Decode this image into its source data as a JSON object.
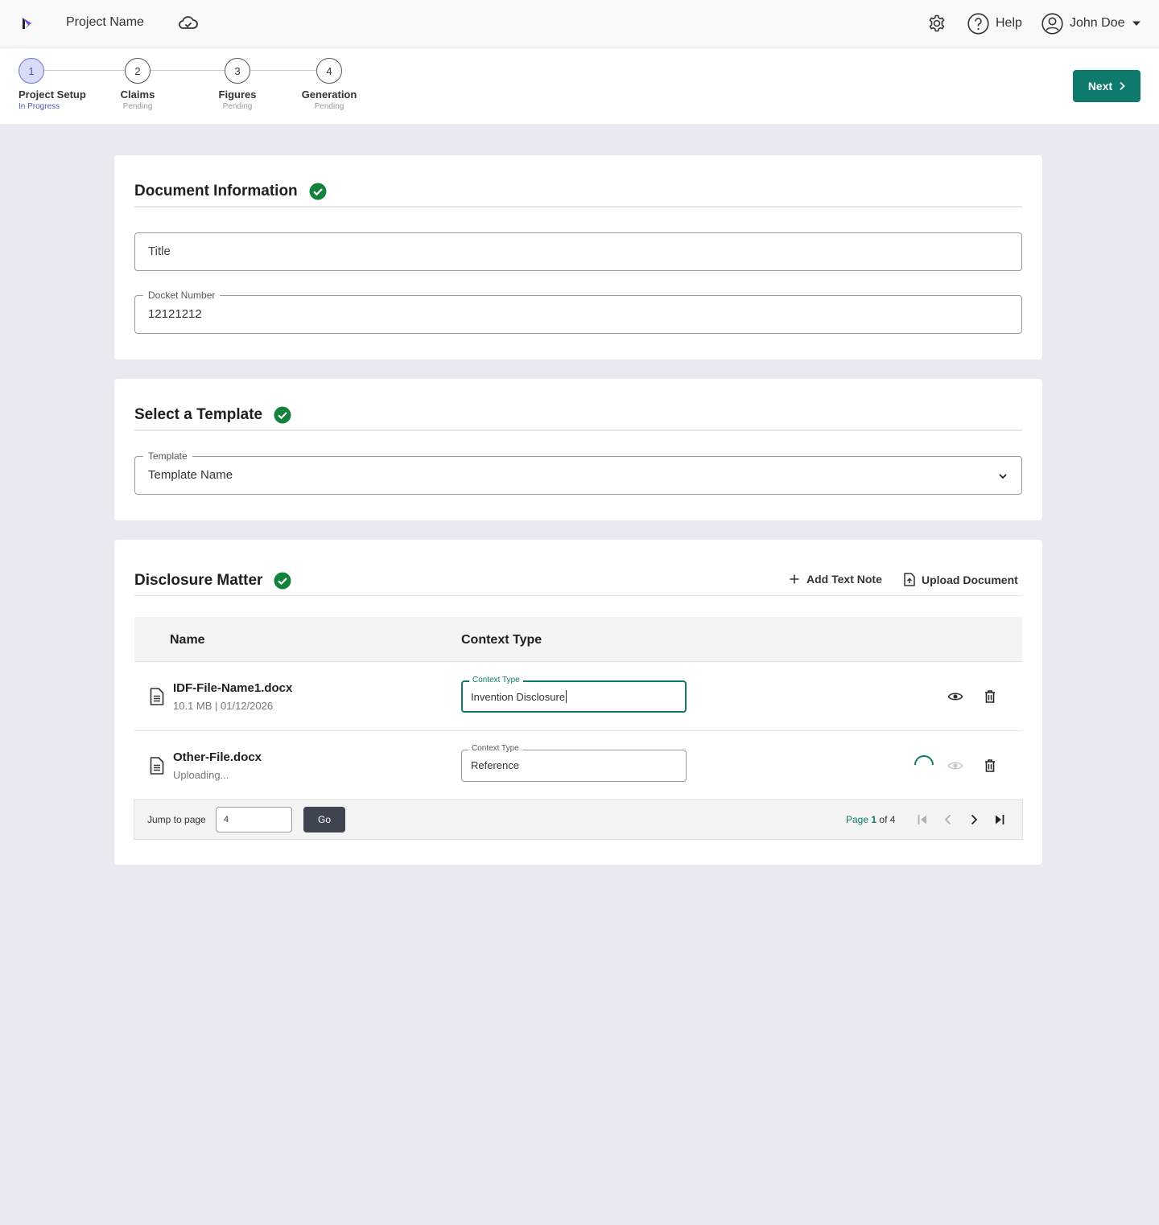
{
  "header": {
    "project_name": "Project Name",
    "help_label": "Help",
    "user_name": "John Doe",
    "icons": [
      "app-logo",
      "cloud-sync-icon",
      "gear-icon",
      "help-icon",
      "user-icon",
      "caret-down-icon"
    ]
  },
  "stepper": {
    "steps": [
      {
        "number": "1",
        "label": "Project Setup",
        "status": "In Progress"
      },
      {
        "number": "2",
        "label": "Claims",
        "status": "Pending"
      },
      {
        "number": "3",
        "label": "Figures",
        "status": "Pending"
      },
      {
        "number": "4",
        "label": "Generation",
        "status": "Pending"
      }
    ],
    "next_label": "Next"
  },
  "document_info": {
    "title": "Document Information",
    "title_field_placeholder": "Title",
    "docket_label": "Docket Number",
    "docket_value": "12121212"
  },
  "template": {
    "title": "Select a Template",
    "field_label": "Template",
    "selected": "Template Name"
  },
  "disclosure": {
    "title": "Disclosure Matter",
    "add_note_label": "Add Text Note",
    "upload_label": "Upload Document",
    "columns": [
      "Name",
      "Context Type"
    ],
    "rows": [
      {
        "name": "IDF-File-Name1.docx",
        "meta": "10.1 MB | 01/12/2026",
        "context_label": "Context Type",
        "context_value": "Invention Disclosure",
        "status": "ready"
      },
      {
        "name": "Other-File.docx",
        "meta": "Uploading...",
        "context_label": "Context Type",
        "context_value": "Reference",
        "status": "uploading"
      }
    ]
  },
  "pagination": {
    "jump_label": "Jump to page",
    "jump_value": "4",
    "go_label": "Go",
    "page_word": "Page",
    "current_page": "1",
    "of_text": "of 4"
  },
  "colors": {
    "accent": "#0d7a6b",
    "step_active": "#4b58b0",
    "success": "#12813a",
    "background": "#eae8f1"
  }
}
